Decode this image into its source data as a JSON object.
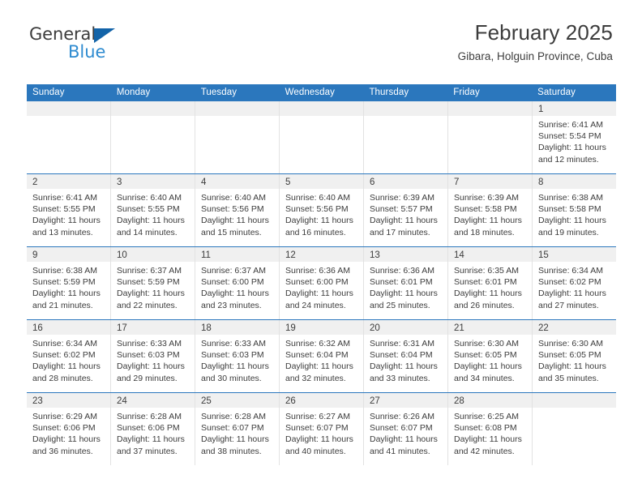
{
  "brand": {
    "name_primary": "General",
    "name_secondary": "Blue",
    "triangle_color": "#1263a8",
    "secondary_color": "#2e8bd0"
  },
  "header": {
    "title": "February 2025",
    "subtitle": "Gibara, Holguin Province, Cuba"
  },
  "theme": {
    "header_row_bg": "#2b77bd",
    "daynum_band_bg": "#f0f0f0",
    "text_color": "#3c3c3c",
    "cell_border": "#e2e2e2"
  },
  "calendar": {
    "weekday_headers": [
      "Sunday",
      "Monday",
      "Tuesday",
      "Wednesday",
      "Thursday",
      "Friday",
      "Saturday"
    ],
    "weeks": [
      [
        {
          "day": "",
          "sunrise": "",
          "sunset": "",
          "daylight_line1": "",
          "daylight_line2": ""
        },
        {
          "day": "",
          "sunrise": "",
          "sunset": "",
          "daylight_line1": "",
          "daylight_line2": ""
        },
        {
          "day": "",
          "sunrise": "",
          "sunset": "",
          "daylight_line1": "",
          "daylight_line2": ""
        },
        {
          "day": "",
          "sunrise": "",
          "sunset": "",
          "daylight_line1": "",
          "daylight_line2": ""
        },
        {
          "day": "",
          "sunrise": "",
          "sunset": "",
          "daylight_line1": "",
          "daylight_line2": ""
        },
        {
          "day": "",
          "sunrise": "",
          "sunset": "",
          "daylight_line1": "",
          "daylight_line2": ""
        },
        {
          "day": "1",
          "sunrise": "Sunrise: 6:41 AM",
          "sunset": "Sunset: 5:54 PM",
          "daylight_line1": "Daylight: 11 hours",
          "daylight_line2": "and 12 minutes."
        }
      ],
      [
        {
          "day": "2",
          "sunrise": "Sunrise: 6:41 AM",
          "sunset": "Sunset: 5:55 PM",
          "daylight_line1": "Daylight: 11 hours",
          "daylight_line2": "and 13 minutes."
        },
        {
          "day": "3",
          "sunrise": "Sunrise: 6:40 AM",
          "sunset": "Sunset: 5:55 PM",
          "daylight_line1": "Daylight: 11 hours",
          "daylight_line2": "and 14 minutes."
        },
        {
          "day": "4",
          "sunrise": "Sunrise: 6:40 AM",
          "sunset": "Sunset: 5:56 PM",
          "daylight_line1": "Daylight: 11 hours",
          "daylight_line2": "and 15 minutes."
        },
        {
          "day": "5",
          "sunrise": "Sunrise: 6:40 AM",
          "sunset": "Sunset: 5:56 PM",
          "daylight_line1": "Daylight: 11 hours",
          "daylight_line2": "and 16 minutes."
        },
        {
          "day": "6",
          "sunrise": "Sunrise: 6:39 AM",
          "sunset": "Sunset: 5:57 PM",
          "daylight_line1": "Daylight: 11 hours",
          "daylight_line2": "and 17 minutes."
        },
        {
          "day": "7",
          "sunrise": "Sunrise: 6:39 AM",
          "sunset": "Sunset: 5:58 PM",
          "daylight_line1": "Daylight: 11 hours",
          "daylight_line2": "and 18 minutes."
        },
        {
          "day": "8",
          "sunrise": "Sunrise: 6:38 AM",
          "sunset": "Sunset: 5:58 PM",
          "daylight_line1": "Daylight: 11 hours",
          "daylight_line2": "and 19 minutes."
        }
      ],
      [
        {
          "day": "9",
          "sunrise": "Sunrise: 6:38 AM",
          "sunset": "Sunset: 5:59 PM",
          "daylight_line1": "Daylight: 11 hours",
          "daylight_line2": "and 21 minutes."
        },
        {
          "day": "10",
          "sunrise": "Sunrise: 6:37 AM",
          "sunset": "Sunset: 5:59 PM",
          "daylight_line1": "Daylight: 11 hours",
          "daylight_line2": "and 22 minutes."
        },
        {
          "day": "11",
          "sunrise": "Sunrise: 6:37 AM",
          "sunset": "Sunset: 6:00 PM",
          "daylight_line1": "Daylight: 11 hours",
          "daylight_line2": "and 23 minutes."
        },
        {
          "day": "12",
          "sunrise": "Sunrise: 6:36 AM",
          "sunset": "Sunset: 6:00 PM",
          "daylight_line1": "Daylight: 11 hours",
          "daylight_line2": "and 24 minutes."
        },
        {
          "day": "13",
          "sunrise": "Sunrise: 6:36 AM",
          "sunset": "Sunset: 6:01 PM",
          "daylight_line1": "Daylight: 11 hours",
          "daylight_line2": "and 25 minutes."
        },
        {
          "day": "14",
          "sunrise": "Sunrise: 6:35 AM",
          "sunset": "Sunset: 6:01 PM",
          "daylight_line1": "Daylight: 11 hours",
          "daylight_line2": "and 26 minutes."
        },
        {
          "day": "15",
          "sunrise": "Sunrise: 6:34 AM",
          "sunset": "Sunset: 6:02 PM",
          "daylight_line1": "Daylight: 11 hours",
          "daylight_line2": "and 27 minutes."
        }
      ],
      [
        {
          "day": "16",
          "sunrise": "Sunrise: 6:34 AM",
          "sunset": "Sunset: 6:02 PM",
          "daylight_line1": "Daylight: 11 hours",
          "daylight_line2": "and 28 minutes."
        },
        {
          "day": "17",
          "sunrise": "Sunrise: 6:33 AM",
          "sunset": "Sunset: 6:03 PM",
          "daylight_line1": "Daylight: 11 hours",
          "daylight_line2": "and 29 minutes."
        },
        {
          "day": "18",
          "sunrise": "Sunrise: 6:33 AM",
          "sunset": "Sunset: 6:03 PM",
          "daylight_line1": "Daylight: 11 hours",
          "daylight_line2": "and 30 minutes."
        },
        {
          "day": "19",
          "sunrise": "Sunrise: 6:32 AM",
          "sunset": "Sunset: 6:04 PM",
          "daylight_line1": "Daylight: 11 hours",
          "daylight_line2": "and 32 minutes."
        },
        {
          "day": "20",
          "sunrise": "Sunrise: 6:31 AM",
          "sunset": "Sunset: 6:04 PM",
          "daylight_line1": "Daylight: 11 hours",
          "daylight_line2": "and 33 minutes."
        },
        {
          "day": "21",
          "sunrise": "Sunrise: 6:30 AM",
          "sunset": "Sunset: 6:05 PM",
          "daylight_line1": "Daylight: 11 hours",
          "daylight_line2": "and 34 minutes."
        },
        {
          "day": "22",
          "sunrise": "Sunrise: 6:30 AM",
          "sunset": "Sunset: 6:05 PM",
          "daylight_line1": "Daylight: 11 hours",
          "daylight_line2": "and 35 minutes."
        }
      ],
      [
        {
          "day": "23",
          "sunrise": "Sunrise: 6:29 AM",
          "sunset": "Sunset: 6:06 PM",
          "daylight_line1": "Daylight: 11 hours",
          "daylight_line2": "and 36 minutes."
        },
        {
          "day": "24",
          "sunrise": "Sunrise: 6:28 AM",
          "sunset": "Sunset: 6:06 PM",
          "daylight_line1": "Daylight: 11 hours",
          "daylight_line2": "and 37 minutes."
        },
        {
          "day": "25",
          "sunrise": "Sunrise: 6:28 AM",
          "sunset": "Sunset: 6:07 PM",
          "daylight_line1": "Daylight: 11 hours",
          "daylight_line2": "and 38 minutes."
        },
        {
          "day": "26",
          "sunrise": "Sunrise: 6:27 AM",
          "sunset": "Sunset: 6:07 PM",
          "daylight_line1": "Daylight: 11 hours",
          "daylight_line2": "and 40 minutes."
        },
        {
          "day": "27",
          "sunrise": "Sunrise: 6:26 AM",
          "sunset": "Sunset: 6:07 PM",
          "daylight_line1": "Daylight: 11 hours",
          "daylight_line2": "and 41 minutes."
        },
        {
          "day": "28",
          "sunrise": "Sunrise: 6:25 AM",
          "sunset": "Sunset: 6:08 PM",
          "daylight_line1": "Daylight: 11 hours",
          "daylight_line2": "and 42 minutes."
        },
        {
          "day": "",
          "sunrise": "",
          "sunset": "",
          "daylight_line1": "",
          "daylight_line2": ""
        }
      ]
    ]
  }
}
